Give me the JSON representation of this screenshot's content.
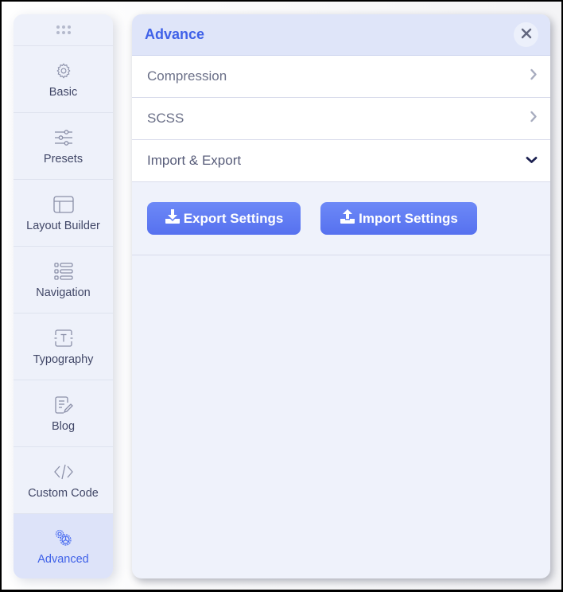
{
  "sidebar": {
    "drag_handle": "drag-handle",
    "items": [
      {
        "label": "Basic",
        "icon": "gear-icon",
        "active": false
      },
      {
        "label": "Presets",
        "icon": "sliders-icon",
        "active": false
      },
      {
        "label": "Layout Builder",
        "icon": "layout-icon",
        "active": false
      },
      {
        "label": "Navigation",
        "icon": "list-icon",
        "active": false
      },
      {
        "label": "Typography",
        "icon": "text-box-icon",
        "active": false
      },
      {
        "label": "Blog",
        "icon": "document-edit-icon",
        "active": false
      },
      {
        "label": "Custom Code",
        "icon": "code-icon",
        "active": false
      },
      {
        "label": "Advanced",
        "icon": "gears-icon",
        "active": true
      }
    ]
  },
  "panel": {
    "title": "Advance",
    "close_icon": "close-icon",
    "sections": [
      {
        "label": "Compression",
        "state": "collapsed",
        "icon": "chevron-right-icon"
      },
      {
        "label": "SCSS",
        "state": "collapsed",
        "icon": "chevron-right-icon"
      },
      {
        "label": "Import & Export",
        "state": "expanded",
        "icon": "chevron-down-icon"
      }
    ],
    "import_export": {
      "export_label": "Export Settings",
      "import_label": "Import Settings"
    }
  },
  "colors": {
    "accent": "#3f61e8",
    "button": "#5f7bf3",
    "sidebar_bg": "#eef1fa",
    "active_bg": "#dde3f9",
    "panel_bg": "#eff2fb",
    "header_bg": "#dfe5f9"
  }
}
